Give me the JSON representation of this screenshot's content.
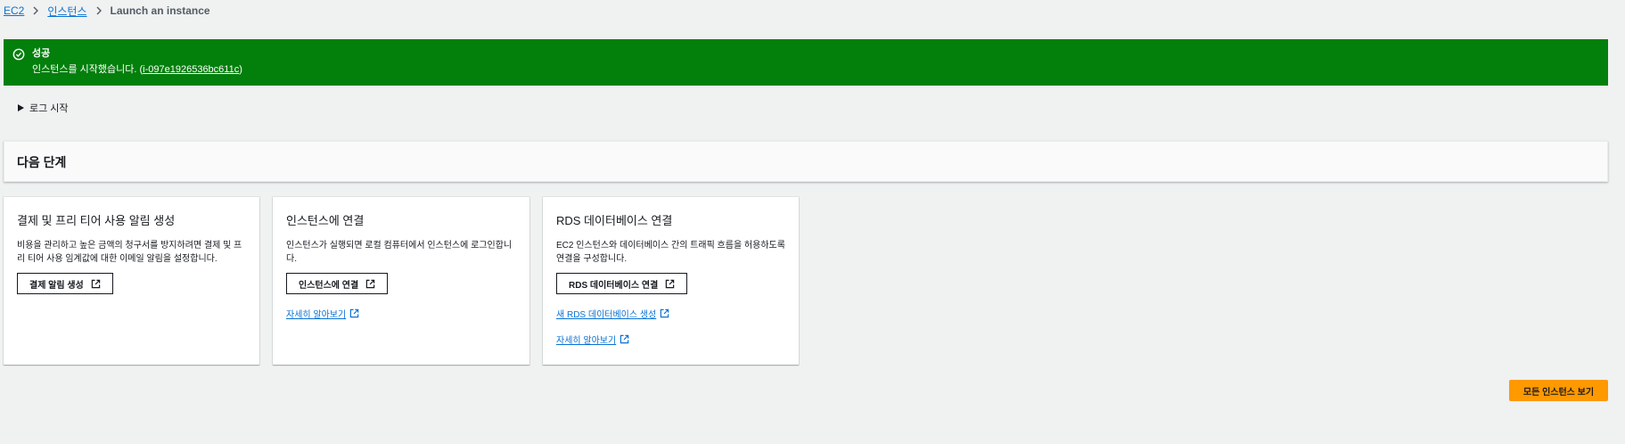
{
  "breadcrumb": {
    "items": [
      "EC2",
      "인스턴스"
    ],
    "current": "Launch an instance"
  },
  "flash": {
    "title": "성공",
    "message_prefix": "인스턴스를 시작했습니다. (",
    "instance_id": "i-097e1926536bc611c",
    "message_suffix": ")",
    "color": "#037f0c"
  },
  "log_toggle": {
    "label": "로그 시작"
  },
  "next_steps": {
    "title": "다음 단계"
  },
  "cards": [
    {
      "title": "결제 및 프리 티어 사용 알림 생성",
      "description": "비용을 관리하고 높은 금액의 청구서를 방지하려면 결제 및 프리 티어 사용 임계값에 대한 이메일 알림을 설정합니다.",
      "button": "결제 알림 생성"
    },
    {
      "title": "인스턴스에 연결",
      "description": "인스턴스가 실행되면 로컬 컴퓨터에서 인스턴스에 로그인합니다.",
      "button": "인스턴스에 연결",
      "links": [
        "자세히 알아보기"
      ]
    },
    {
      "title": "RDS 데이터베이스 연결",
      "description": "EC2 인스턴스와 데이터베이스 간의 트래픽 흐름을 허용하도록 연결을 구성합니다.",
      "button": "RDS 데이터베이스 연결",
      "links": [
        "새 RDS 데이터베이스 생성",
        "자세히 알아보기"
      ]
    }
  ],
  "view_all_button": {
    "label": "모든 인스턴스 보기",
    "color": "#ff9900"
  },
  "icons": {
    "success": "check-circle-icon",
    "external": "external-link-icon",
    "separator": "chevron-right-icon"
  }
}
